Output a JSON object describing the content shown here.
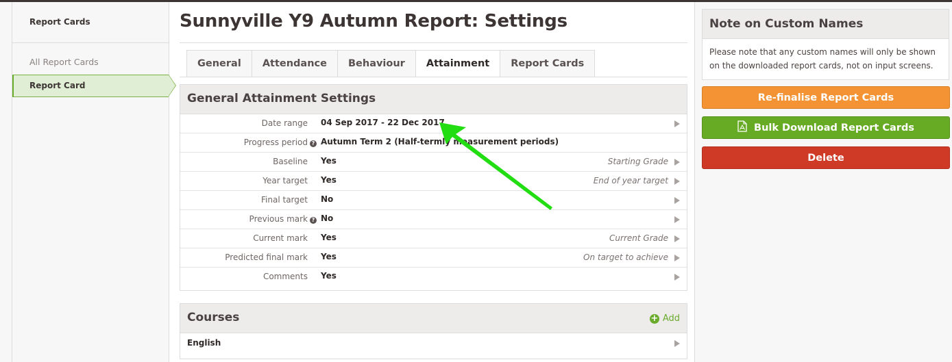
{
  "sidebar": {
    "title": "Report Cards",
    "items": [
      {
        "label": "All Report Cards",
        "active": false
      },
      {
        "label": "Report Card",
        "active": true
      }
    ]
  },
  "page": {
    "title": "Sunnyville Y9 Autumn Report: Settings"
  },
  "tabs": [
    {
      "label": "General",
      "active": false
    },
    {
      "label": "Attendance",
      "active": false
    },
    {
      "label": "Behaviour",
      "active": false
    },
    {
      "label": "Attainment",
      "active": true
    },
    {
      "label": "Report Cards",
      "active": false
    }
  ],
  "attainment": {
    "title": "General Attainment Settings",
    "rows": [
      {
        "label": "Date range",
        "help": false,
        "value": "04 Sep 2017 - 22 Dec 2017",
        "hint": "",
        "chevron": true
      },
      {
        "label": "Progress period",
        "help": true,
        "value": "Autumn Term 2 (Half-termly measurement periods)",
        "hint": "",
        "chevron": false
      },
      {
        "label": "Baseline",
        "help": false,
        "value": "Yes",
        "hint": "Starting Grade",
        "chevron": true
      },
      {
        "label": "Year target",
        "help": false,
        "value": "Yes",
        "hint": "End of year target",
        "chevron": true
      },
      {
        "label": "Final target",
        "help": false,
        "value": "No",
        "hint": "",
        "chevron": true
      },
      {
        "label": "Previous mark",
        "help": true,
        "value": "No",
        "hint": "",
        "chevron": true
      },
      {
        "label": "Current mark",
        "help": false,
        "value": "Yes",
        "hint": "Current Grade",
        "chevron": true
      },
      {
        "label": "Predicted final mark",
        "help": false,
        "value": "Yes",
        "hint": "On target to achieve",
        "chevron": true
      },
      {
        "label": "Comments",
        "help": false,
        "value": "Yes",
        "hint": "",
        "chevron": true
      }
    ]
  },
  "courses": {
    "title": "Courses",
    "add_label": "Add",
    "items": [
      {
        "name": "English"
      }
    ]
  },
  "note": {
    "title": "Note on Custom Names",
    "body": "Please note that any custom names will only be shown on the downloaded report cards, not on input screens."
  },
  "actions": {
    "refinalise": "Re-finalise Report Cards",
    "bulk_download": "Bulk Download Report Cards",
    "delete": "Delete"
  },
  "colors": {
    "accent_green": "#67aa24",
    "orange": "#f39333",
    "red": "#cf3a26",
    "annotation_arrow": "#22dd11"
  }
}
